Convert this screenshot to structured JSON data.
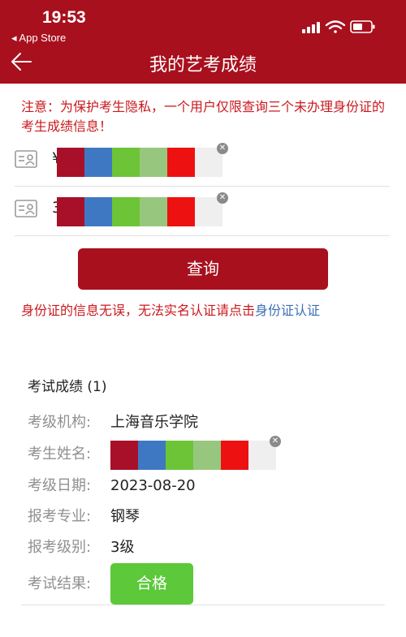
{
  "status_bar": {
    "time": "19:53",
    "back_app": "◂ App Store"
  },
  "nav": {
    "title": "我的艺考成绩",
    "back_icon": "arrow-left-icon"
  },
  "notice": "注意：为保护考生隐私，一个用户仅限查询三个未办理身份证的考生成绩信息！",
  "id_entries": [
    {
      "prefix": "¥",
      "icon": "id-card-icon"
    },
    {
      "prefix": "3",
      "icon": "id-card-icon"
    }
  ],
  "redaction_colors": [
    "#a8102a",
    "#3f78c2",
    "#6cc436",
    "#97c77e",
    "#ee1111",
    "#efefef"
  ],
  "query_button": "查询",
  "hint": {
    "text": "身份证的信息无误，无法实名认证请点击",
    "link": "身份证认证"
  },
  "result": {
    "title": "考试成绩 (1)",
    "fields": [
      {
        "label": "考级机构:",
        "value": "上海音乐学院"
      },
      {
        "label": "考生姓名:",
        "value": ""
      },
      {
        "label": "考级日期:",
        "value": "2023-08-20"
      },
      {
        "label": "报考专业:",
        "value": "钢琴"
      },
      {
        "label": "报考级别:",
        "value": "3级"
      },
      {
        "label": "考试结果:",
        "value": "合格"
      }
    ]
  },
  "colors": {
    "brand": "#a8101e",
    "notice_red": "#c9191e",
    "link_blue": "#3a6fb5",
    "pass_green": "#5cc83a"
  }
}
